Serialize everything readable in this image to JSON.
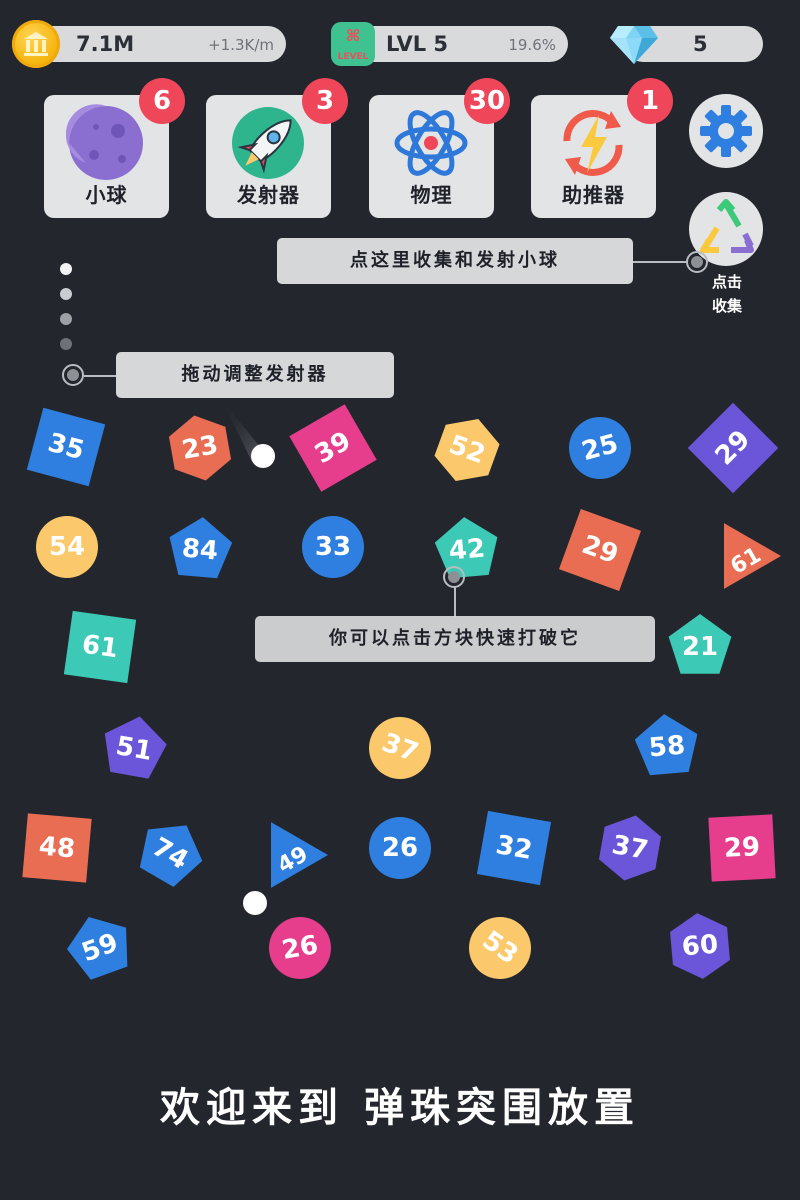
{
  "stats": {
    "money": "7.1M",
    "rate": "+1.3K/m",
    "level_badge": "LEVEL",
    "level": "LVL 5",
    "progress": "19.6%",
    "gems": "5"
  },
  "cards": [
    {
      "label": "小球",
      "badge": "6",
      "icon": "planet-icon"
    },
    {
      "label": "发射器",
      "badge": "3",
      "icon": "rocket-icon"
    },
    {
      "label": "物理",
      "badge": "30",
      "icon": "atom-icon"
    },
    {
      "label": "助推器",
      "badge": "1",
      "icon": "boost-icon"
    }
  ],
  "buttons": {
    "settings": "gear-icon",
    "collect": "recycle-icon",
    "collect_label_1": "点击",
    "collect_label_2": "收集"
  },
  "tips": {
    "collect": "点这里收集和发射小球",
    "launcher": "拖动调整发射器",
    "tap_blocks": "你可以点击方块快速打破它"
  },
  "blocks": [
    {
      "shape": "square",
      "color": "#2f7fe0",
      "value": "35",
      "rot": 15
    },
    {
      "shape": "hexagon",
      "color": "#e86d52",
      "value": "23",
      "rot": -10
    },
    {
      "shape": "square",
      "color": "#e63d8d",
      "value": "39",
      "rot": -30
    },
    {
      "shape": "hexagon",
      "color": "#fbc96b",
      "value": "52",
      "rot": 20
    },
    {
      "shape": "circle",
      "color": "#2f7fe0",
      "value": "25",
      "rot": -15
    },
    {
      "shape": "square",
      "color": "#6b55d8",
      "value": "29",
      "rot": -45
    },
    {
      "shape": "circle",
      "color": "#fbc96b",
      "value": "54",
      "rot": 0
    },
    {
      "shape": "pentagon",
      "color": "#2f7fe0",
      "value": "84",
      "rot": 5
    },
    {
      "shape": "circle",
      "color": "#2f7fe0",
      "value": "33",
      "rot": 0
    },
    {
      "shape": "pentagon",
      "color": "#3cc9b5",
      "value": "42",
      "rot": -5
    },
    {
      "shape": "square",
      "color": "#e86d52",
      "value": "29",
      "rot": 20
    },
    {
      "shape": "triangle",
      "color": "#e86d52",
      "value": "61",
      "rot": -30
    },
    {
      "shape": "square",
      "color": "#3cc9b5",
      "value": "61",
      "rot": 8
    },
    {
      "shape": "pentagon",
      "color": "#3cc9b5",
      "value": "21",
      "rot": 0
    },
    {
      "shape": "pentagon",
      "color": "#6b55d8",
      "value": "51",
      "rot": 10
    },
    {
      "shape": "circle",
      "color": "#fbc96b",
      "value": "37",
      "rot": 20
    },
    {
      "shape": "pentagon",
      "color": "#2f7fe0",
      "value": "58",
      "rot": -5
    },
    {
      "shape": "square",
      "color": "#e86d52",
      "value": "48",
      "rot": 5
    },
    {
      "shape": "pentagon",
      "color": "#2f7fe0",
      "value": "74",
      "rot": 30
    },
    {
      "shape": "triangle",
      "color": "#2f7fe0",
      "value": "49",
      "rot": -30
    },
    {
      "shape": "circle",
      "color": "#2f7fe0",
      "value": "26",
      "rot": 0
    },
    {
      "shape": "square",
      "color": "#2f7fe0",
      "value": "32",
      "rot": 10
    },
    {
      "shape": "hexagon",
      "color": "#6b55d8",
      "value": "37",
      "rot": 10
    },
    {
      "shape": "square",
      "color": "#e63d8d",
      "value": "29",
      "rot": -3
    },
    {
      "shape": "pentagon",
      "color": "#2f7fe0",
      "value": "59",
      "rot": -20
    },
    {
      "shape": "circle",
      "color": "#e63d8d",
      "value": "26",
      "rot": -10
    },
    {
      "shape": "circle",
      "color": "#fbc96b",
      "value": "53",
      "rot": 35
    },
    {
      "shape": "hexagon",
      "color": "#6b55d8",
      "value": "60",
      "rot": -5
    }
  ],
  "welcome": "欢迎来到 弹珠突围放置"
}
